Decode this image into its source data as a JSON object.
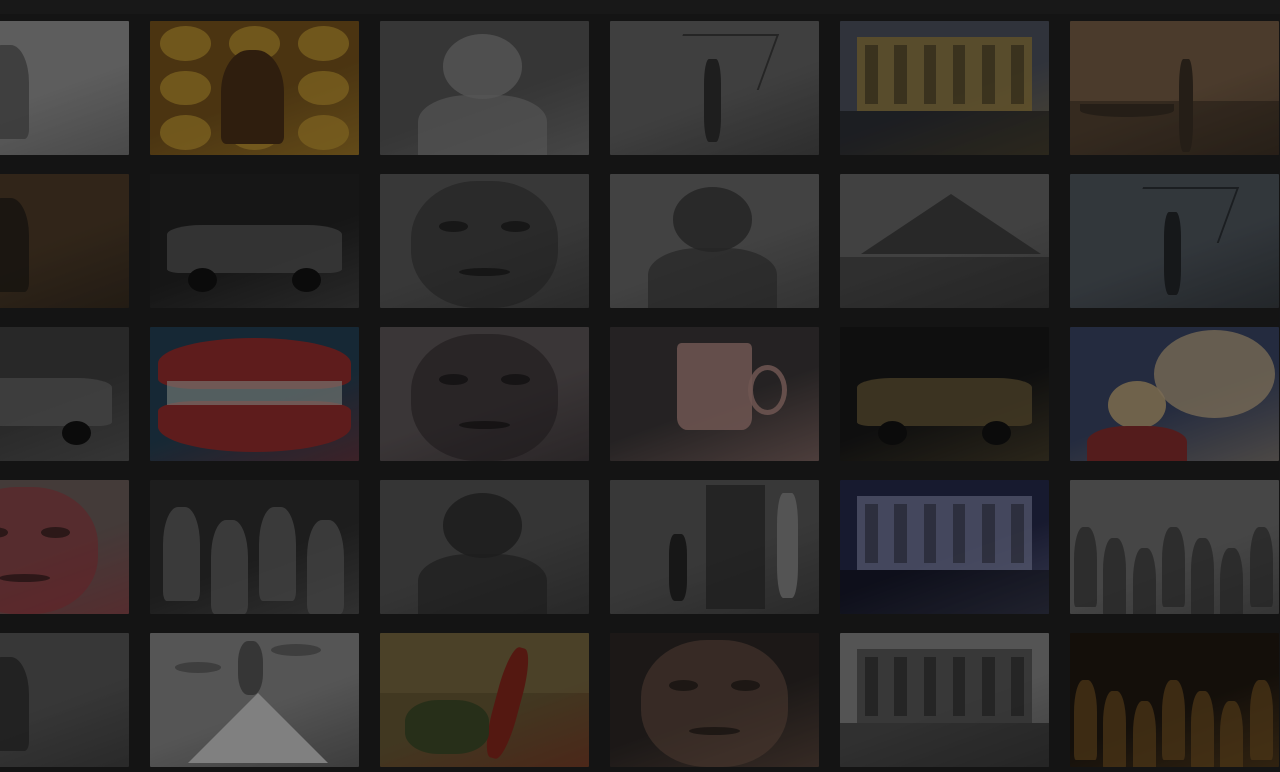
{
  "gallery": {
    "tiles": [
      {
        "name": "tile-r1c1",
        "bg": "#9a9a9a",
        "accent": "#5a5a5a",
        "motif": "figure"
      },
      {
        "name": "tile-r1c2",
        "bg": "#7a5418",
        "accent": "#c79a2e",
        "motif": "flowers"
      },
      {
        "name": "tile-r1c3",
        "bg": "#565656",
        "accent": "#8a8a8a",
        "motif": "portrait"
      },
      {
        "name": "tile-r1c4",
        "bg": "#666666",
        "accent": "#2e2e2e",
        "motif": "silhouette"
      },
      {
        "name": "tile-r1c5",
        "bg": "#4d5260",
        "accent": "#a88b3e",
        "motif": "building"
      },
      {
        "name": "tile-r1c6",
        "bg": "#7a5f45",
        "accent": "#3a2e22",
        "motif": "boat"
      },
      {
        "name": "tile-r2c1",
        "bg": "#4e3a25",
        "accent": "#1f1a14",
        "motif": "figure"
      },
      {
        "name": "tile-r2c2",
        "bg": "#202020",
        "accent": "#5b5b5b",
        "motif": "car"
      },
      {
        "name": "tile-r2c3",
        "bg": "#5b5b5b",
        "accent": "#2e2e2e",
        "motif": "face"
      },
      {
        "name": "tile-r2c4",
        "bg": "#6c6c6c",
        "accent": "#3a3a3a",
        "motif": "portrait"
      },
      {
        "name": "tile-r2c5",
        "bg": "#6a6a6a",
        "accent": "#3f3f3f",
        "motif": "mountain"
      },
      {
        "name": "tile-r2c6",
        "bg": "#505860",
        "accent": "#1f2327",
        "motif": "silhouette"
      },
      {
        "name": "tile-r3c1",
        "bg": "#3e3e3e",
        "accent": "#6a6a6a",
        "motif": "car"
      },
      {
        "name": "tile-r3c2",
        "bg": "#1f3f55",
        "accent": "#9c2a2a",
        "motif": "lips"
      },
      {
        "name": "tile-r3c3",
        "bg": "#5e5658",
        "accent": "#2a2326",
        "motif": "face"
      },
      {
        "name": "tile-r3c4",
        "bg": "#3a3536",
        "accent": "#b98d86",
        "motif": "mug"
      },
      {
        "name": "tile-r3c5",
        "bg": "#141414",
        "accent": "#6c5c37",
        "motif": "car"
      },
      {
        "name": "tile-r3c6",
        "bg": "#384466",
        "accent": "#b9a27a",
        "motif": "child"
      },
      {
        "name": "tile-r4c1",
        "bg": "#6e5f5c",
        "accent": "#a8313b",
        "motif": "face"
      },
      {
        "name": "tile-r4c2",
        "bg": "#2b2b2b",
        "accent": "#6a6a6a",
        "motif": "group"
      },
      {
        "name": "tile-r4c3",
        "bg": "#555555",
        "accent": "#2c2c2c",
        "motif": "portrait"
      },
      {
        "name": "tile-r4c4",
        "bg": "#5a5a5a",
        "accent": "#2e2e2e",
        "motif": "doorway"
      },
      {
        "name": "tile-r4c5",
        "bg": "#22264a",
        "accent": "#8a8fb5",
        "motif": "building"
      },
      {
        "name": "tile-r4c6",
        "bg": "#737373",
        "accent": "#3a3a3a",
        "motif": "crowd"
      },
      {
        "name": "tile-r5c1",
        "bg": "#595959",
        "accent": "#2c2c2c",
        "motif": "figure"
      },
      {
        "name": "tile-r5c2",
        "bg": "#8c8c8c",
        "accent": "#3e3e3e",
        "motif": "pyramid"
      },
      {
        "name": "tile-r5c3",
        "bg": "#6a5a33",
        "accent": "#8a2418",
        "motif": "painting"
      },
      {
        "name": "tile-r5c4",
        "bg": "#2a2422",
        "accent": "#7e5d4c",
        "motif": "face"
      },
      {
        "name": "tile-r5c5",
        "bg": "#8a8a8a",
        "accent": "#4a4a4a",
        "motif": "building"
      },
      {
        "name": "tile-r5c6",
        "bg": "#1c140c",
        "accent": "#7a5420",
        "motif": "crowd"
      }
    ]
  }
}
